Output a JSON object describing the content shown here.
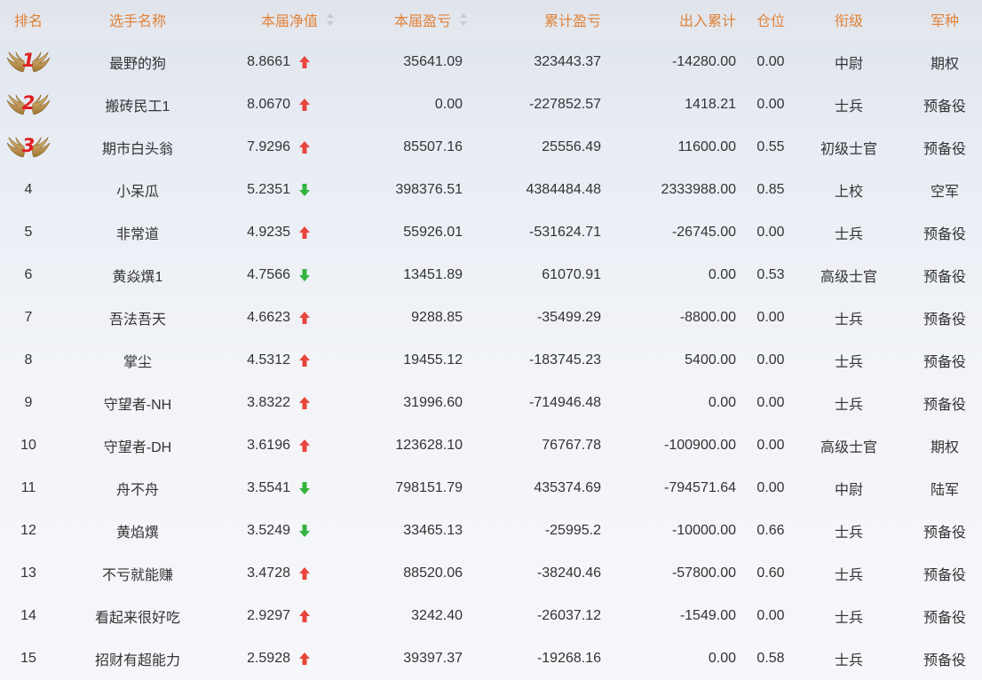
{
  "header": {
    "rank": "排名",
    "name": "选手名称",
    "net_value": "本届净值",
    "round_pnl": "本届盈亏",
    "total_pnl": "累计盈亏",
    "cash_flow": "出入累计",
    "position": "仓位",
    "rank_title": "衔级",
    "branch": "军种"
  },
  "colors": {
    "header_text": "#e0833a",
    "arrow_up": "#e8453c",
    "arrow_down": "#33b43f",
    "medal_number": "#e02020",
    "medal_wing": "#c99a52"
  },
  "rows": [
    {
      "rank": "1",
      "medal": true,
      "name": "最野的狗",
      "net_value": "8.8661",
      "trend": "up",
      "round_pnl": "35641.09",
      "total_pnl": "323443.37",
      "cash_flow": "-14280.00",
      "position": "0.00",
      "rank_title": "中尉",
      "branch": "期权"
    },
    {
      "rank": "2",
      "medal": true,
      "name": "搬砖民工1",
      "net_value": "8.0670",
      "trend": "up",
      "round_pnl": "0.00",
      "total_pnl": "-227852.57",
      "cash_flow": "1418.21",
      "position": "0.00",
      "rank_title": "士兵",
      "branch": "预备役"
    },
    {
      "rank": "3",
      "medal": true,
      "name": "期市白头翁",
      "net_value": "7.9296",
      "trend": "up",
      "round_pnl": "85507.16",
      "total_pnl": "25556.49",
      "cash_flow": "11600.00",
      "position": "0.55",
      "rank_title": "初级士官",
      "branch": "预备役"
    },
    {
      "rank": "4",
      "medal": false,
      "name": "小呆瓜",
      "net_value": "5.2351",
      "trend": "down",
      "round_pnl": "398376.51",
      "total_pnl": "4384484.48",
      "cash_flow": "2333988.00",
      "position": "0.85",
      "rank_title": "上校",
      "branch": "空军"
    },
    {
      "rank": "5",
      "medal": false,
      "name": "非常道",
      "net_value": "4.9235",
      "trend": "up",
      "round_pnl": "55926.01",
      "total_pnl": "-531624.71",
      "cash_flow": "-26745.00",
      "position": "0.00",
      "rank_title": "士兵",
      "branch": "预备役"
    },
    {
      "rank": "6",
      "medal": false,
      "name": "黄焱熼1",
      "net_value": "4.7566",
      "trend": "down",
      "round_pnl": "13451.89",
      "total_pnl": "61070.91",
      "cash_flow": "0.00",
      "position": "0.53",
      "rank_title": "高级士官",
      "branch": "预备役"
    },
    {
      "rank": "7",
      "medal": false,
      "name": "吾法吾天",
      "net_value": "4.6623",
      "trend": "up",
      "round_pnl": "9288.85",
      "total_pnl": "-35499.29",
      "cash_flow": "-8800.00",
      "position": "0.00",
      "rank_title": "士兵",
      "branch": "预备役"
    },
    {
      "rank": "8",
      "medal": false,
      "name": "掌尘",
      "net_value": "4.5312",
      "trend": "up",
      "round_pnl": "19455.12",
      "total_pnl": "-183745.23",
      "cash_flow": "5400.00",
      "position": "0.00",
      "rank_title": "士兵",
      "branch": "预备役"
    },
    {
      "rank": "9",
      "medal": false,
      "name": "守望者-NH",
      "net_value": "3.8322",
      "trend": "up",
      "round_pnl": "31996.60",
      "total_pnl": "-714946.48",
      "cash_flow": "0.00",
      "position": "0.00",
      "rank_title": "士兵",
      "branch": "预备役"
    },
    {
      "rank": "10",
      "medal": false,
      "name": "守望者-DH",
      "net_value": "3.6196",
      "trend": "up",
      "round_pnl": "123628.10",
      "total_pnl": "76767.78",
      "cash_flow": "-100900.00",
      "position": "0.00",
      "rank_title": "高级士官",
      "branch": "期权"
    },
    {
      "rank": "11",
      "medal": false,
      "name": "舟不舟",
      "net_value": "3.5541",
      "trend": "down",
      "round_pnl": "798151.79",
      "total_pnl": "435374.69",
      "cash_flow": "-794571.64",
      "position": "0.00",
      "rank_title": "中尉",
      "branch": "陆军"
    },
    {
      "rank": "12",
      "medal": false,
      "name": "黄焰熼",
      "net_value": "3.5249",
      "trend": "down",
      "round_pnl": "33465.13",
      "total_pnl": "-25995.2",
      "cash_flow": "-10000.00",
      "position": "0.66",
      "rank_title": "士兵",
      "branch": "预备役"
    },
    {
      "rank": "13",
      "medal": false,
      "name": "不亏就能赚",
      "net_value": "3.4728",
      "trend": "up",
      "round_pnl": "88520.06",
      "total_pnl": "-38240.46",
      "cash_flow": "-57800.00",
      "position": "0.60",
      "rank_title": "士兵",
      "branch": "预备役"
    },
    {
      "rank": "14",
      "medal": false,
      "name": "看起来很好吃",
      "net_value": "2.9297",
      "trend": "up",
      "round_pnl": "3242.40",
      "total_pnl": "-26037.12",
      "cash_flow": "-1549.00",
      "position": "0.00",
      "rank_title": "士兵",
      "branch": "预备役"
    },
    {
      "rank": "15",
      "medal": false,
      "name": "招财有超能力",
      "net_value": "2.5928",
      "trend": "up",
      "round_pnl": "39397.37",
      "total_pnl": "-19268.16",
      "cash_flow": "0.00",
      "position": "0.58",
      "rank_title": "士兵",
      "branch": "预备役"
    }
  ]
}
